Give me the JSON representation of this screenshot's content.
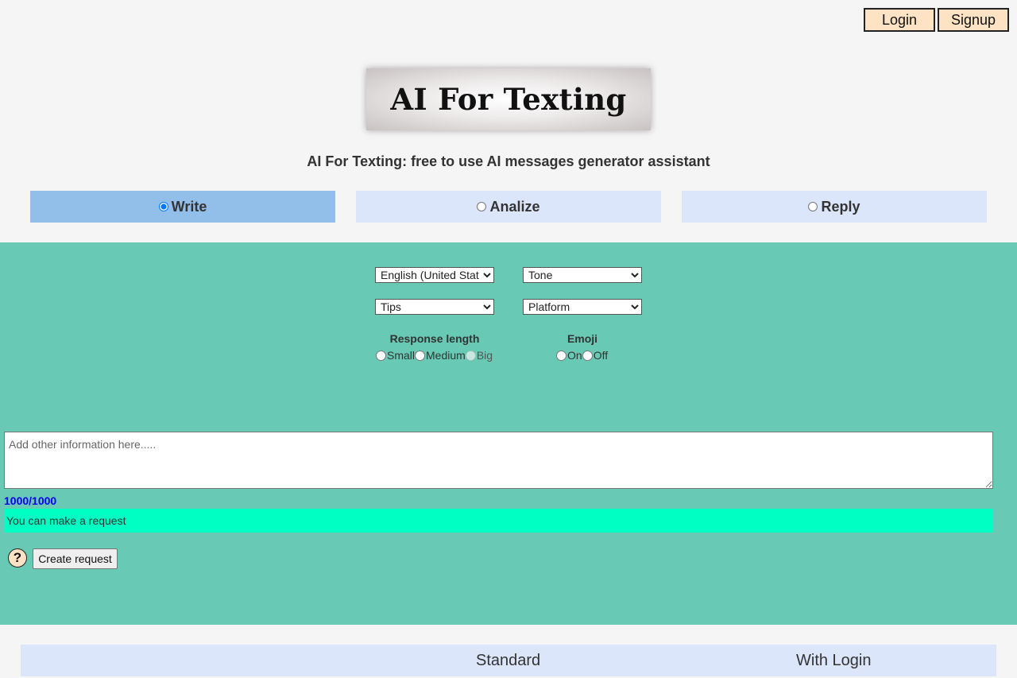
{
  "header": {
    "login_label": "Login",
    "signup_label": "Signup"
  },
  "logo": {
    "text": "AI For Texting"
  },
  "subtitle": "AI For Texting: free to use AI messages generator assistant",
  "modes": [
    {
      "label": "Write",
      "selected": true
    },
    {
      "label": "Analize",
      "selected": false
    },
    {
      "label": "Reply",
      "selected": false
    }
  ],
  "options": {
    "language_selected": "English (United States)",
    "tone_selected": "Tone",
    "tips_selected": "Tips",
    "platform_selected": "Platform"
  },
  "response_length": {
    "title": "Response length",
    "options": [
      "Small",
      "Medium",
      "Big"
    ]
  },
  "emoji": {
    "title": "Emoji",
    "options": [
      "On",
      "Off"
    ]
  },
  "info": {
    "placeholder": "Add other information here.....",
    "counter": "1000/1000",
    "status": "You can make a request"
  },
  "actions": {
    "help_label": "?",
    "create_label": "Create request"
  },
  "plans": {
    "standard_label": "Standard",
    "login_label": "With Login"
  },
  "colors": {
    "panel": "#68c9b4",
    "active_tab": "#92bfea",
    "inactive_tab": "#dce6fb",
    "status_bar": "#00ffc3",
    "auth_button": "#fde3c4",
    "counter": "#0000ee"
  }
}
